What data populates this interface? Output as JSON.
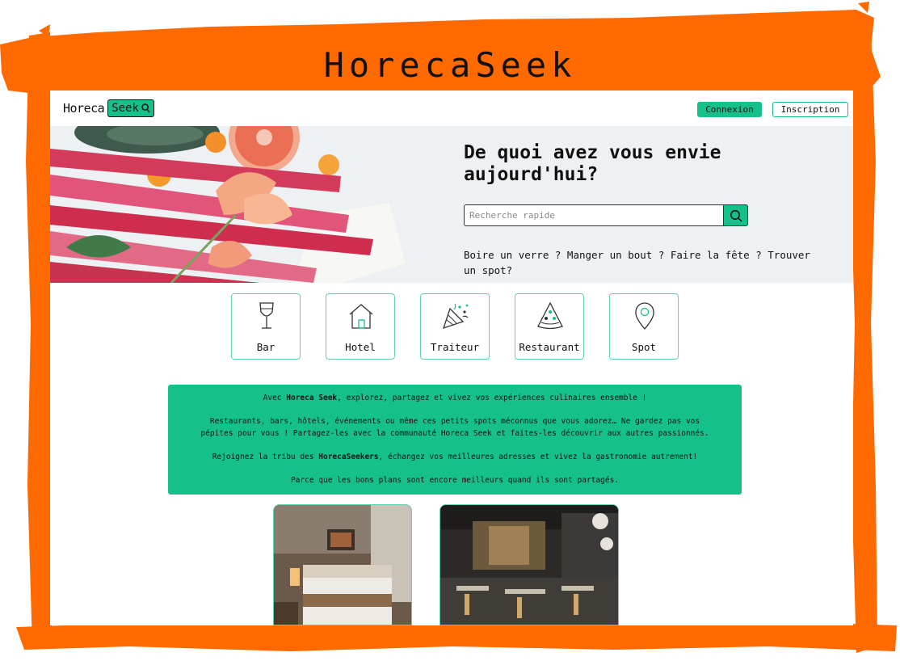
{
  "banner": {
    "title": "HorecaSeek"
  },
  "header": {
    "logo_text": "Horeca",
    "logo_box_text": "Seek",
    "connexion_label": "Connexion",
    "inscription_label": "Inscription"
  },
  "hero": {
    "title": "De quoi avez vous envie aujourd'hui?",
    "search_placeholder": "Recherche rapide",
    "tagline": "Boire un verre ? Manger un bout ? Faire la fête ? Trouver un spot?"
  },
  "categories": [
    {
      "label": "Bar",
      "icon": "wine-glass-icon"
    },
    {
      "label": "Hotel",
      "icon": "house-icon"
    },
    {
      "label": "Traiteur",
      "icon": "party-popper-icon"
    },
    {
      "label": "Restaurant",
      "icon": "pizza-slice-icon"
    },
    {
      "label": "Spot",
      "icon": "map-pin-icon"
    }
  ],
  "info": {
    "line1_pre": "Avec ",
    "line1_bold": "Horeca Seek",
    "line1_post": ", explorez, partagez et vivez vos expériences culinaires ensemble !",
    "line2": "Restaurants, bars, hôtels, événements ou même ces petits spots méconnus que vous adorez… Ne gardez pas vos pépites pour vous ! Partagez-les avec la communauté Horeca Seek et faites-les découvrir aux autres passionnés.",
    "line3_pre": "Rejoignez la tribu des ",
    "line3_bold": "HorecaSeekers",
    "line3_post": ", échangez vos meilleures adresses et vivez la gastronomie autrement!",
    "line4": "Parce que les bons plans sont encore meilleurs quand ils sont partagés."
  },
  "colors": {
    "frame_orange": "#ff6a00",
    "brand_green": "#16c08a",
    "accent_border": "#5fd3ad"
  }
}
